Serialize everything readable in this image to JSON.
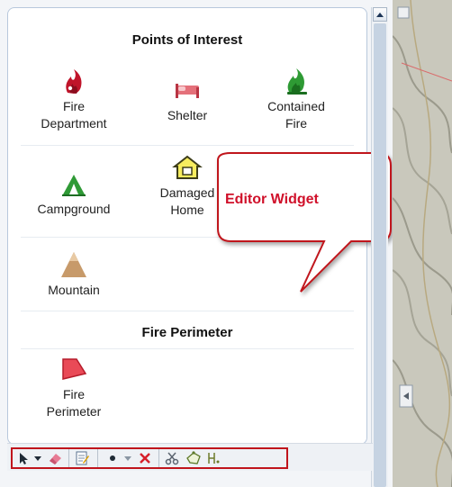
{
  "editor": {
    "sections": [
      {
        "title": "Points of Interest",
        "items": [
          {
            "label": "Fire\nDepartment",
            "icon": "fire-department-icon"
          },
          {
            "label": "Shelter",
            "icon": "shelter-icon"
          },
          {
            "label": "Contained\nFire",
            "icon": "contained-fire-icon"
          },
          {
            "label": "Campground",
            "icon": "campground-icon"
          },
          {
            "label": "Damaged\nHome",
            "icon": "damaged-home-icon"
          },
          {
            "label": "Mountain",
            "icon": "mountain-icon"
          }
        ]
      },
      {
        "title": "Fire Perimeter",
        "items": [
          {
            "label": "Fire\nPerimeter",
            "icon": "fire-perimeter-icon"
          }
        ]
      }
    ]
  },
  "callout": {
    "text": "Editor Widget",
    "color": "#d0102a"
  },
  "toolbar": {
    "tools": [
      "select-arrow-icon",
      "dropdown-arrow-icon",
      "eraser-icon",
      "attributes-icon",
      "point-icon",
      "dropdown-arrow-icon",
      "delete-x-icon",
      "cut-scissors-icon",
      "reshape-icon",
      "merge-icon"
    ],
    "highlight_color": "#c0141c"
  }
}
